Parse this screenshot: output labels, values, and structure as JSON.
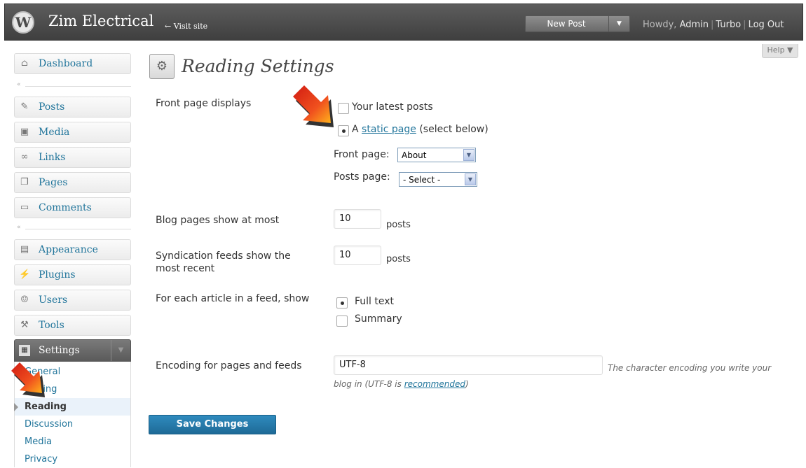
{
  "header": {
    "site_title": "Zim Electrical",
    "visit_site": "← Visit site",
    "new_post": "New Post",
    "howdy_prefix": "Howdy, ",
    "user": "Admin",
    "turbo": "Turbo",
    "logout": "Log Out",
    "separator": "|"
  },
  "help": "Help ▼",
  "sidebar": {
    "items": [
      {
        "label": "Dashboard",
        "icon": "home-icon"
      },
      {
        "label": "Posts",
        "icon": "pin-icon"
      },
      {
        "label": "Media",
        "icon": "media-icon"
      },
      {
        "label": "Links",
        "icon": "link-icon"
      },
      {
        "label": "Pages",
        "icon": "pages-icon"
      },
      {
        "label": "Comments",
        "icon": "comment-icon"
      },
      {
        "label": "Appearance",
        "icon": "appearance-icon"
      },
      {
        "label": "Plugins",
        "icon": "plug-icon"
      },
      {
        "label": "Users",
        "icon": "users-icon"
      },
      {
        "label": "Tools",
        "icon": "tools-icon"
      }
    ],
    "settings": {
      "label": "Settings"
    },
    "submenu": [
      {
        "label": "General"
      },
      {
        "label": "Writing"
      },
      {
        "label": "Reading",
        "current": true
      },
      {
        "label": "Discussion"
      },
      {
        "label": "Media"
      },
      {
        "label": "Privacy"
      }
    ]
  },
  "page_title": "Reading Settings",
  "form": {
    "front_page": {
      "label": "Front page displays",
      "latest": "Your latest posts",
      "static_prefix": "A ",
      "static_link": "static page",
      "static_suffix": " (select below)",
      "front_page_label": "Front page:",
      "front_page_value": "About",
      "posts_page_label": "Posts page:",
      "posts_page_value": "- Select -"
    },
    "blog_pages": {
      "label": "Blog pages show at most",
      "value": "10",
      "unit": "posts"
    },
    "syndication": {
      "label": "Syndication feeds show the most recent",
      "value": "10",
      "unit": "posts"
    },
    "feed_article": {
      "label": "For each article in a feed, show",
      "full": "Full text",
      "summary": "Summary"
    },
    "encoding": {
      "label": "Encoding for pages and feeds",
      "value": "UTF-8",
      "desc1": "The character encoding you write your",
      "desc2_prefix": "blog in (UTF-8 is ",
      "desc2_link": "recommended",
      "desc2_suffix": ")"
    }
  },
  "save_button": "Save Changes",
  "colors": {
    "link": "#21759b",
    "header": "#464646",
    "button": "#21759b",
    "arrow": "#e23a1a"
  }
}
